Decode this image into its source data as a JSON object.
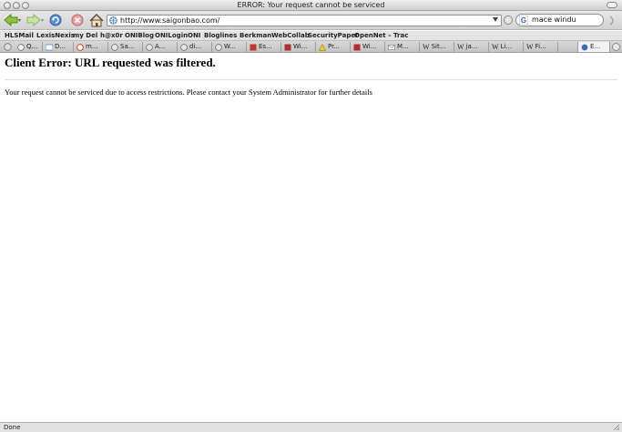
{
  "window": {
    "title": "ERROR: Your request cannot be serviced"
  },
  "toolbar": {
    "url": "http://www.saigonbao.com/",
    "search_query": "mace windu"
  },
  "bookmarks": [
    {
      "label": "HLSMail"
    },
    {
      "label": "LexisNexis"
    },
    {
      "label": "my Del"
    },
    {
      "label": "h@x0r"
    },
    {
      "label": "ONIBlog"
    },
    {
      "label": "ONILogin"
    },
    {
      "label": "ONI"
    },
    {
      "label": "Bloglines"
    },
    {
      "label": "Berkman"
    },
    {
      "label": "WebCollab"
    },
    {
      "label": "SecurityPaper"
    },
    {
      "label": "OpenNet – Trac"
    }
  ],
  "tabs": [
    {
      "label": "Q..."
    },
    {
      "label": "D..."
    },
    {
      "label": "m..."
    },
    {
      "label": "Sa..."
    },
    {
      "label": "A..."
    },
    {
      "label": "di..."
    },
    {
      "label": "W..."
    },
    {
      "label": "Es..."
    },
    {
      "label": "Wi..."
    },
    {
      "label": "Pr..."
    },
    {
      "label": "Wi..."
    },
    {
      "label": "M..."
    },
    {
      "label": "Sit..."
    },
    {
      "label": "ja..."
    },
    {
      "label": "Li..."
    },
    {
      "label": "Fi..."
    },
    {
      "label": "E..."
    }
  ],
  "content": {
    "heading": "Client Error: URL requested was filtered.",
    "message": "Your request cannot be serviced due to access restrictions. Please contact your System Administrator for further details"
  },
  "status": {
    "text": "Done"
  }
}
